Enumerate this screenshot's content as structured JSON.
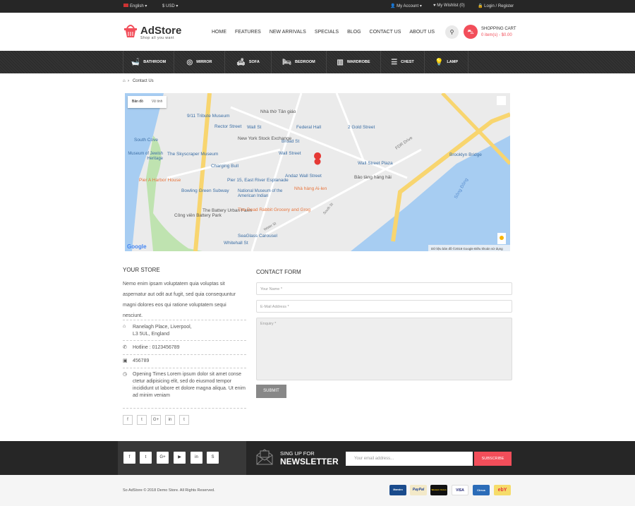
{
  "topbar": {
    "language": "English",
    "currency": "$ USD",
    "account": "My Account",
    "wishlist": "My Wishlist (0)",
    "login": "Login / Register"
  },
  "header": {
    "logo_title": "AdStore",
    "logo_tagline": "Shop all you want",
    "nav": [
      "HOME",
      "FEATURES",
      "NEW ARRIVALS",
      "SPECIALS",
      "BLOG",
      "CONTACT US",
      "ABOUT US"
    ],
    "cart_title": "SHOPPING CART",
    "cart_value": "0 item(s) - $0.00"
  },
  "categories": [
    {
      "label": "BATHROOM",
      "icon": "bathtub-icon"
    },
    {
      "label": "MIRROR",
      "icon": "mirror-icon"
    },
    {
      "label": "SOFA",
      "icon": "sofa-icon"
    },
    {
      "label": "BEDROOM",
      "icon": "bed-icon"
    },
    {
      "label": "WARDROBE",
      "icon": "wardrobe-icon"
    },
    {
      "label": "CHEST",
      "icon": "chest-icon"
    },
    {
      "label": "LAMP",
      "icon": "lamp-icon"
    }
  ],
  "breadcrumb": {
    "current": "Contact Us"
  },
  "map": {
    "tabs": [
      "Bản đồ",
      "Vệ tinh"
    ],
    "labels": [
      "9/11 Tribute Museum",
      "Rector Street",
      "Wall St",
      "Federal Hall",
      "Nhà thờ Tân giáo",
      "2 Gold Street",
      "New York Stock Exchange",
      "Broad St",
      "South Cove",
      "The Skyscraper Museum",
      "Museum of Jewish Heritage",
      "Wall Street",
      "Charging Bull",
      "Andaz Wall Street",
      "Wall Street Plaza",
      "Pier A Harbor House",
      "Bowling Green Subway",
      "National Museum of the American Indian",
      "Nhà hàng Ai-len",
      "The Dead Rabbit Grocery and Grog",
      "The Battery Urban Farm",
      "Công viên Battery Park",
      "SeaGlass Carousel",
      "Whitehall St",
      "Pier 15, East River Esplanade",
      "Bảo tàng hàng hải",
      "Brooklyn Bridge",
      "FDR Drive",
      "Sông Đông",
      "Water St",
      "South St"
    ],
    "google": "Google",
    "attribution": "Dữ liệu bản đồ ©2018 Google   Điều khoản sử dụng"
  },
  "store": {
    "title": "YOUR STORE",
    "description": "Nemo enim ipsam voluptatem quia voluptas sit aspernatur aut odit aut fugit, sed quia consequuntur magni dolores eos qui ratione voluptatem sequi nesciunt.",
    "address1": "Ranelagh Place, Liverpool,",
    "address2": "L3 5UL, England",
    "hotline": "Hotline : 0123456789",
    "fax": "456789",
    "hours": "Opening Times Lorem ipsum dolor sit amet conse ctetur adipisicing elit, sed do eiusmod tempor incididunt ut labore et dolore magna aliqua. Ut enim ad minim veniam",
    "social": [
      "f",
      "t",
      "G+",
      "in",
      "t"
    ]
  },
  "form": {
    "title": "CONTACT FORM",
    "name_placeholder": "Your Name *",
    "email_placeholder": "E-Mail Address *",
    "enquiry_placeholder": "Enquiry *",
    "submit": "SUBMIT"
  },
  "footer": {
    "social": [
      "f",
      "t",
      "G+",
      "▶",
      "in",
      "S"
    ],
    "newsletter_small": "SING UP FOR",
    "newsletter_big": "NEWSLETTER",
    "email_placeholder": "Your email address...",
    "subscribe": "SUBSCRIBE",
    "copyright": "So AdStore © 2018 Demo Store. All Rights Reserved.",
    "payments": [
      "Maestro",
      "PayPal",
      "Western Union",
      "VISA",
      "Cirrus",
      "ebY"
    ]
  },
  "colors": {
    "accent": "#f24e5a",
    "dark": "#262626"
  }
}
